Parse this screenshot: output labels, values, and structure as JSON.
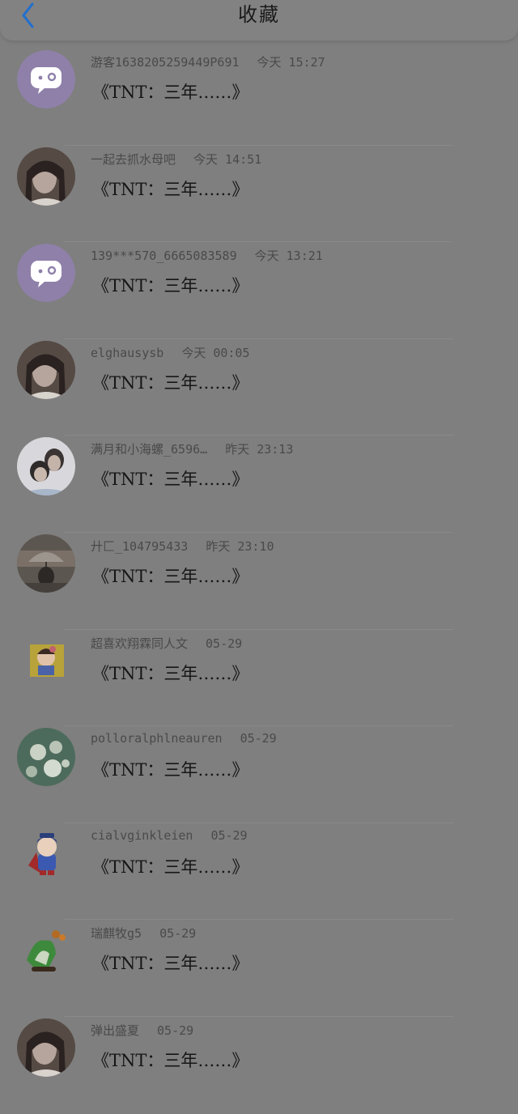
{
  "header": {
    "title": "收藏"
  },
  "items": [
    {
      "user": "游客1638205259449P691",
      "time": "今天 15:27",
      "title": "《TNT：三年……》",
      "avatar": "chat-bubble-icon"
    },
    {
      "user": "一起去抓水母吧",
      "time": "今天 14:51",
      "title": "《TNT：三年……》",
      "avatar": "photo-portrait"
    },
    {
      "user": "139***570_6665083589",
      "time": "今天 13:21",
      "title": "《TNT：三年……》",
      "avatar": "chat-bubble-icon"
    },
    {
      "user": "elghausysb",
      "time": "今天 00:05",
      "title": "《TNT：三年……》",
      "avatar": "photo-portrait"
    },
    {
      "user": "满月和小海螺_6596…",
      "time": "昨天 23:13",
      "title": "《TNT：三年……》",
      "avatar": "photo-couple"
    },
    {
      "user": "廾匚_104795433",
      "time": "昨天 23:10",
      "title": "《TNT：三年……》",
      "avatar": "photo-umbrella"
    },
    {
      "user": "超喜欢翔霖同人文",
      "time": "05-29",
      "title": "《TNT：三年……》",
      "avatar": "cartoon-sticker"
    },
    {
      "user": "polloralphlneauren",
      "time": "05-29",
      "title": "《TNT：三年……》",
      "avatar": "flower-photo"
    },
    {
      "user": "cialvginkleien",
      "time": "05-29",
      "title": "《TNT：三年……》",
      "avatar": "cartoon-superman"
    },
    {
      "user": "瑞麒牧g5",
      "time": "05-29",
      "title": "《TNT：三年……》",
      "avatar": "jade-cabbage"
    },
    {
      "user": "弹出盛夏",
      "time": "05-29",
      "title": "《TNT：三年……》",
      "avatar": "photo-portrait"
    }
  ],
  "colors": {
    "back_arrow": "#1f6fd0",
    "chat_avatar_bg": "#8e80a9"
  }
}
